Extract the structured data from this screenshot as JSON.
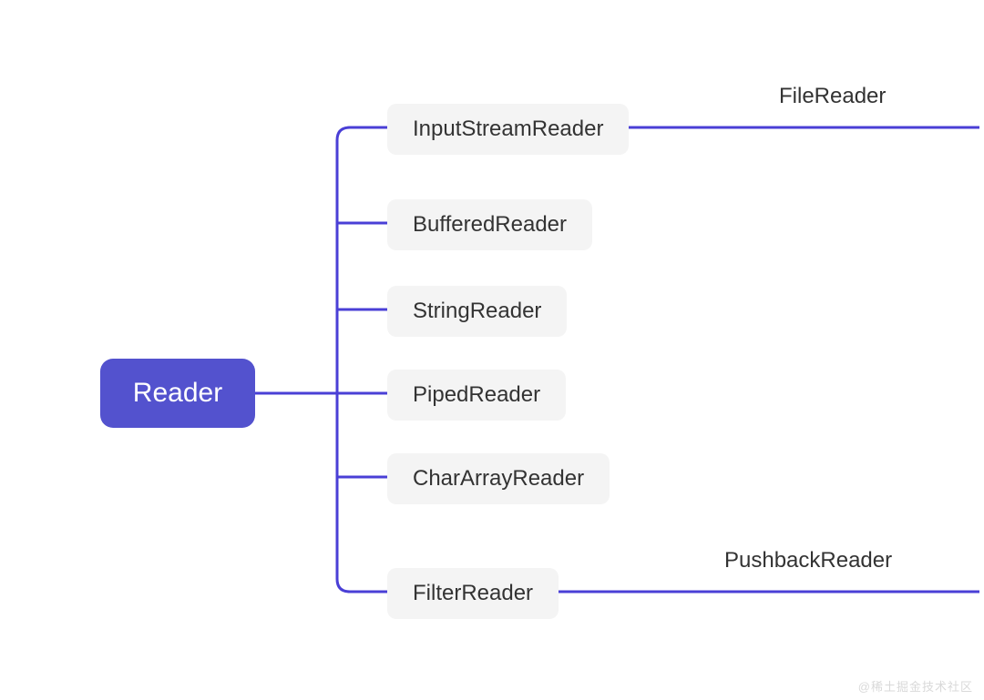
{
  "colors": {
    "root_bg": "#5352ce",
    "root_text": "#ffffff",
    "child_bg": "#f4f4f4",
    "child_text": "#333333",
    "line": "#4a3fd6"
  },
  "diagram": {
    "root": "Reader",
    "children": [
      {
        "label": "InputStreamReader",
        "leaf": "FileReader"
      },
      {
        "label": "BufferedReader",
        "leaf": null
      },
      {
        "label": "StringReader",
        "leaf": null
      },
      {
        "label": "PipedReader",
        "leaf": null
      },
      {
        "label": "CharArrayReader",
        "leaf": null
      },
      {
        "label": "FilterReader",
        "leaf": "PushbackReader"
      }
    ],
    "watermark": "@稀土掘金技术社区"
  }
}
